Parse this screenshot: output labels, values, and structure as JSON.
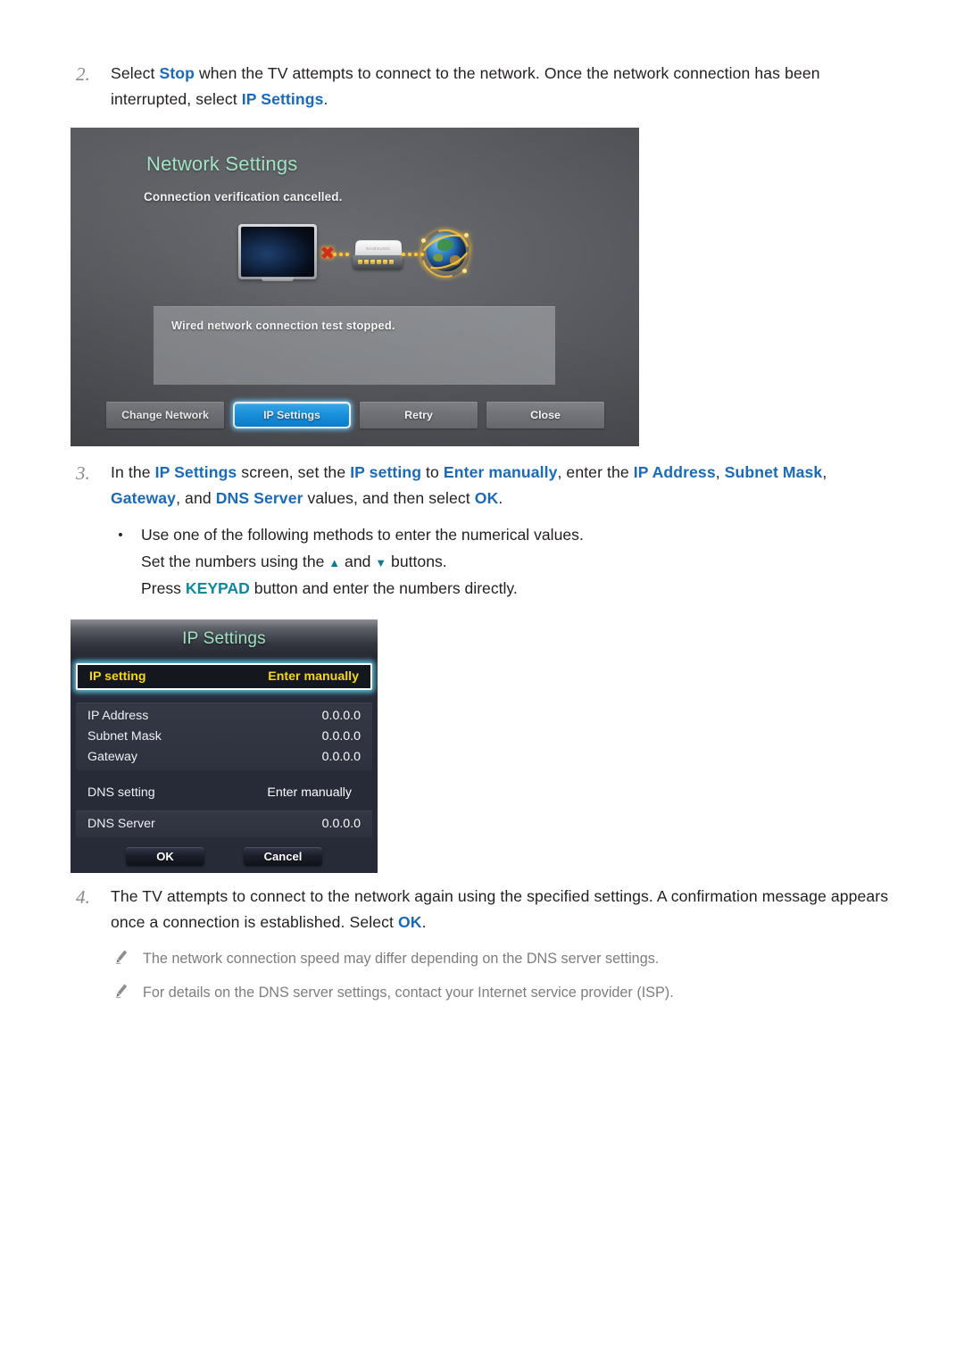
{
  "steps": [
    {
      "number": "2.",
      "segments": [
        {
          "t": "Select ",
          "s": "n"
        },
        {
          "t": "Stop",
          "s": "b"
        },
        {
          "t": " when the TV attempts to connect to the network. Once the network connection has been interrupted, select ",
          "s": "n"
        },
        {
          "t": "IP Settings",
          "s": "b"
        },
        {
          "t": ".",
          "s": "n"
        }
      ]
    },
    {
      "number": "3.",
      "segments": [
        {
          "t": "In the ",
          "s": "n"
        },
        {
          "t": "IP Settings",
          "s": "b"
        },
        {
          "t": " screen, set the ",
          "s": "n"
        },
        {
          "t": "IP setting",
          "s": "b"
        },
        {
          "t": " to ",
          "s": "n"
        },
        {
          "t": "Enter manually",
          "s": "b"
        },
        {
          "t": ", enter the ",
          "s": "n"
        },
        {
          "t": "IP Address",
          "s": "b"
        },
        {
          "t": ", ",
          "s": "n"
        },
        {
          "t": "Subnet Mask",
          "s": "b"
        },
        {
          "t": ", ",
          "s": "n"
        },
        {
          "t": "Gateway",
          "s": "b"
        },
        {
          "t": ", and ",
          "s": "n"
        },
        {
          "t": "DNS Server",
          "s": "b"
        },
        {
          "t": " values, and then select ",
          "s": "n"
        },
        {
          "t": "OK",
          "s": "b"
        },
        {
          "t": ".",
          "s": "n"
        }
      ]
    },
    {
      "number": "4.",
      "segments": [
        {
          "t": "The TV attempts to connect to the network again using the specified settings. A confirmation message appears once a connection is established. Select ",
          "s": "n"
        },
        {
          "t": "OK",
          "s": "b"
        },
        {
          "t": ".",
          "s": "n"
        }
      ]
    }
  ],
  "bullets": {
    "dot": "•",
    "lead": "Use one of the following methods to enter the numerical values.",
    "method_1_pre": "Set the numbers using the ",
    "method_1_up": "▲",
    "method_1_mid": " and ",
    "method_1_down": "▼",
    "method_1_post": " buttons.",
    "method_2_pre": "Press ",
    "method_2_key": "KEYPAD",
    "method_2_post": " button and enter the numbers directly."
  },
  "notes": [
    "The network connection speed may differ depending on the DNS server settings.",
    "For details on the DNS server settings, contact your Internet service provider (ISP)."
  ],
  "network_panel": {
    "title": "Network Settings",
    "subtitle": "Connection verification cancelled.",
    "message": "Wired network connection test stopped.",
    "router_brand": "SAMSUNG",
    "buttons": [
      {
        "label": "Change Network",
        "selected": false
      },
      {
        "label": "IP Settings",
        "selected": true
      },
      {
        "label": "Retry",
        "selected": false
      },
      {
        "label": "Close",
        "selected": false
      }
    ]
  },
  "ip_panel": {
    "title": "IP Settings",
    "ip_setting": {
      "label": "IP setting",
      "value": "Enter manually"
    },
    "address_rows": [
      {
        "label": "IP Address",
        "value": "0.0.0.0"
      },
      {
        "label": "Subnet Mask",
        "value": "0.0.0.0"
      },
      {
        "label": "Gateway",
        "value": "0.0.0.0"
      }
    ],
    "dns_setting": {
      "label": "DNS setting",
      "value": "Enter manually"
    },
    "dns_server": {
      "label": "DNS Server",
      "value": "0.0.0.0"
    },
    "ok_label": "OK",
    "cancel_label": "Cancel"
  },
  "colors": {
    "link_blue": "#1a6ab8",
    "keypad_teal": "#0e8a9c",
    "panel_title_green": "#9fe3c2",
    "highlight_yellow": "#f5d617",
    "selected_button_blue": "#1a9bec",
    "note_grey": "#7d7d7d"
  }
}
